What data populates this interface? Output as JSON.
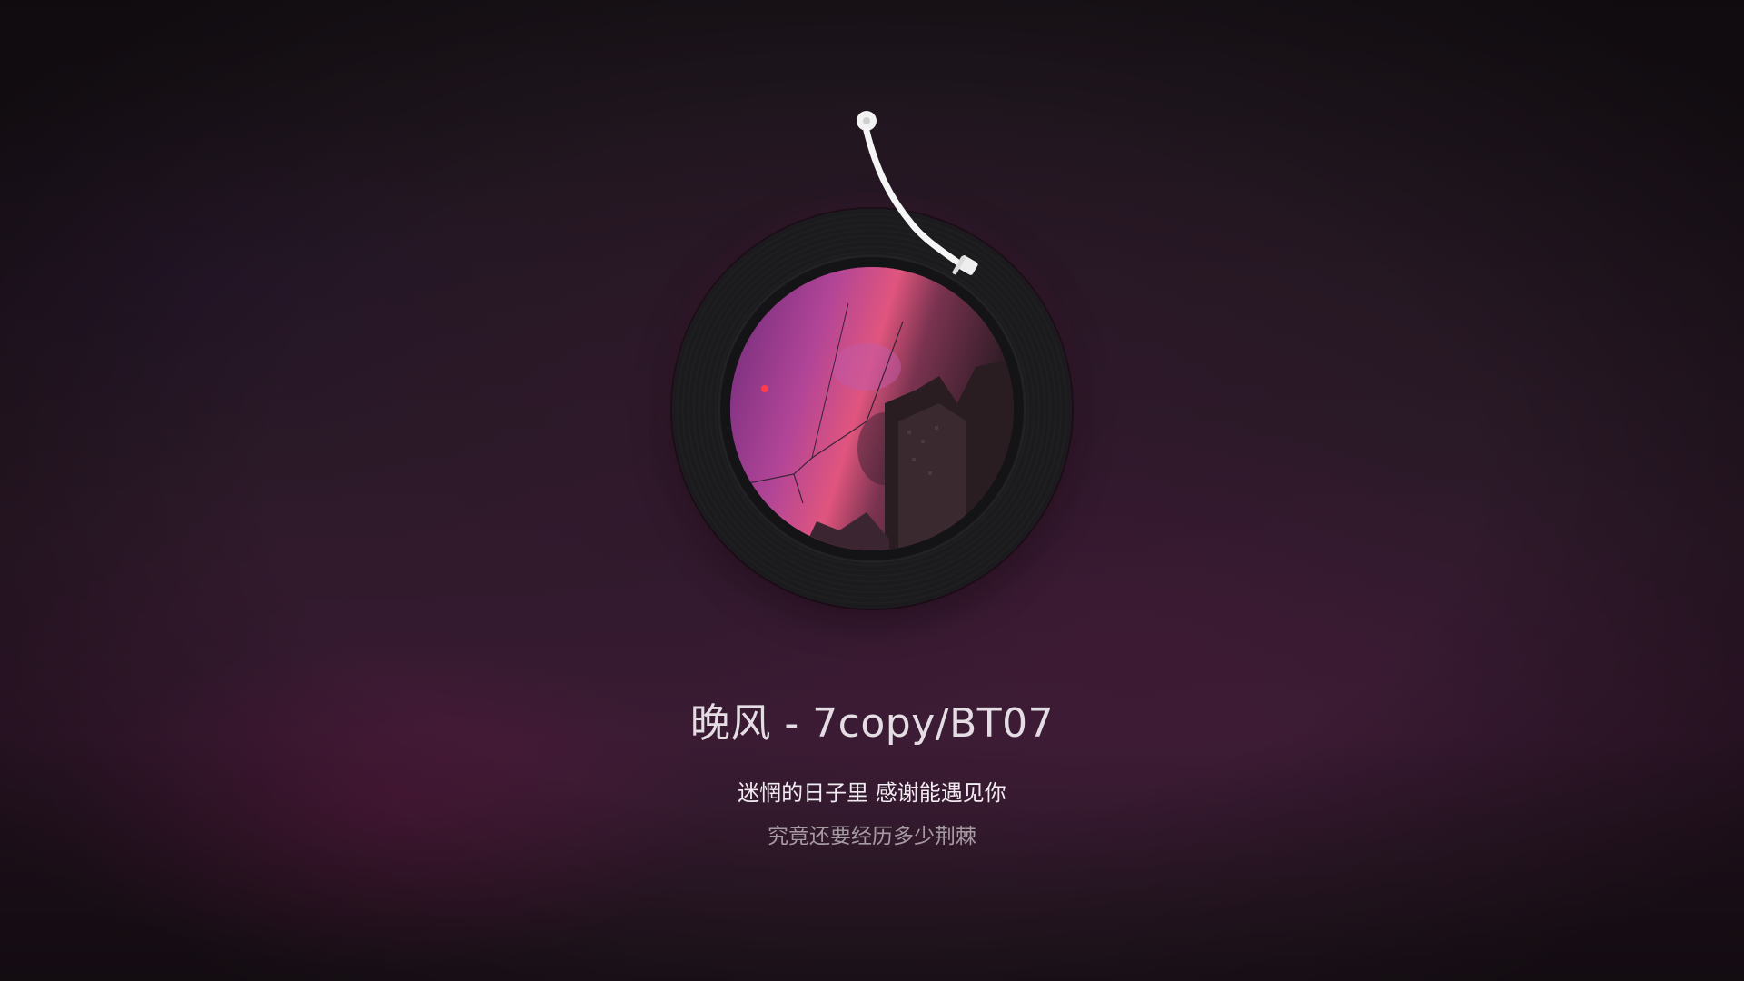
{
  "player": {
    "song_title": "晚风 - 7copy/BT07",
    "lyrics": {
      "current": "迷惘的日子里 感谢能遇见你",
      "next": "究竟还要经历多少荆棘"
    },
    "cover_art": "night-sky-pink-sunset-buildings",
    "icons": {
      "tonearm": "tonearm-icon"
    }
  },
  "colors": {
    "background_dark": "#1f1620",
    "background_accent": "#3a1b33",
    "record_black": "#1b1b1e",
    "title_text": "#e4dde4",
    "lyric_current": "#f1ecf1",
    "lyric_next": "#a69aa3"
  }
}
